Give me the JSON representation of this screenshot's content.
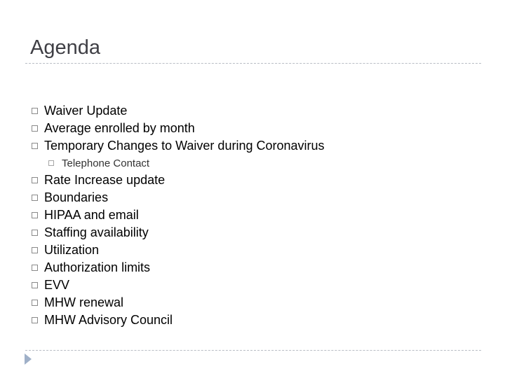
{
  "slide": {
    "title": "Agenda",
    "items": [
      {
        "label": "Waiver Update",
        "level": 1
      },
      {
        "label": "Average enrolled by month",
        "level": 1
      },
      {
        "label": "Temporary Changes to Waiver during Coronavirus",
        "level": 1
      },
      {
        "label": "Telephone Contact",
        "level": 2
      },
      {
        "label": "Rate Increase update",
        "level": 1
      },
      {
        "label": "Boundaries",
        "level": 1
      },
      {
        "label": "HIPAA and email",
        "level": 1
      },
      {
        "label": "Staffing availability",
        "level": 1
      },
      {
        "label": "Utilization",
        "level": 1
      },
      {
        "label": "Authorization limits",
        "level": 1
      },
      {
        "label": "EVV",
        "level": 1
      },
      {
        "label": "MHW renewal",
        "level": 1
      },
      {
        "label": "MHW Advisory Council",
        "level": 1
      }
    ],
    "bullet_icon": "hollow-square",
    "nav_icon": "play-triangle",
    "colors": {
      "title": "#3f3f45",
      "text": "#000000",
      "rule": "#b8bcc4",
      "nav_arrow": "#9fb0c8"
    }
  }
}
